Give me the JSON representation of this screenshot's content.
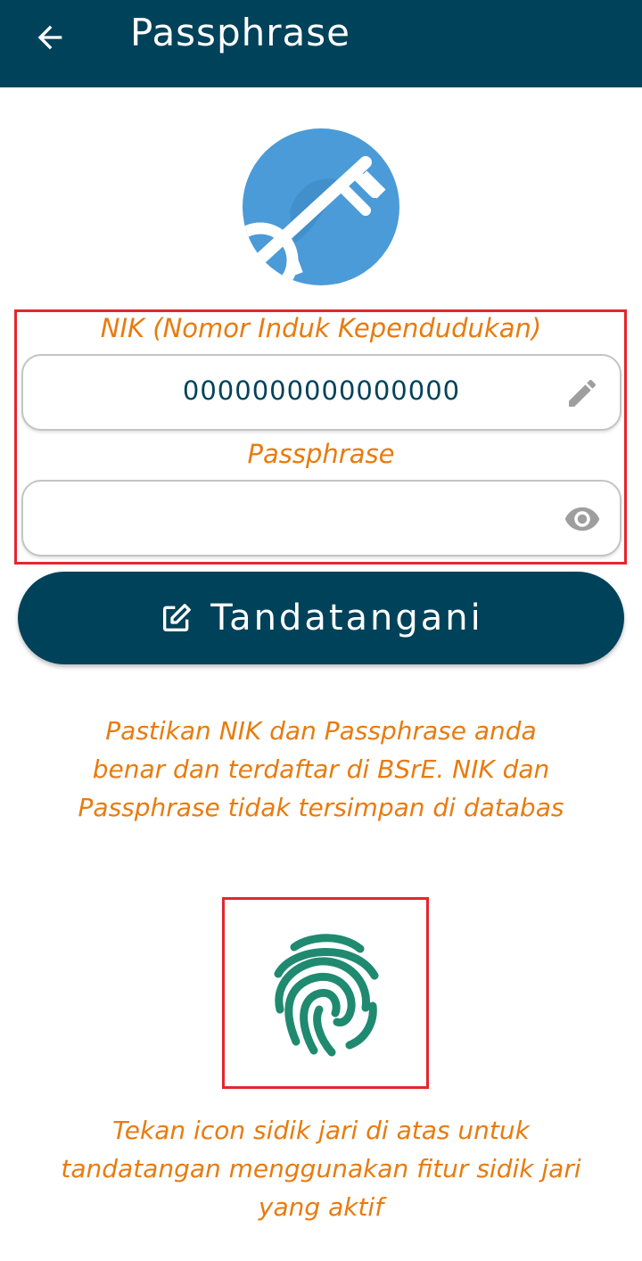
{
  "appbar": {
    "title": "Passphrase",
    "back_icon": "arrow-left-icon"
  },
  "logo": {
    "icon": "key-logo-icon"
  },
  "form": {
    "nik_label": "NIK (Nomor Induk Kependudukan)",
    "nik_value": "0000000000000000",
    "nik_icon": "pencil-edit-icon",
    "passphrase_label": "Passphrase",
    "passphrase_value": "",
    "passphrase_icon": "eye-icon"
  },
  "sign_button": {
    "label": "Tandatangani",
    "icon": "edit-square-icon"
  },
  "info_text": "Pastikan NIK dan Passphrase anda benar dan terdaftar di BSrE. NIK dan Passphrase tidak tersimpan di databas",
  "fingerprint": {
    "icon": "fingerprint-icon",
    "hint": "Tekan icon sidik jari di atas untuk tandatangan menggunakan fitur sidik jari yang aktif"
  },
  "colors": {
    "primary": "#00425a",
    "accent_text": "#e87b0f",
    "highlight_box": "#e3262d",
    "fingerprint": "#1f8a70",
    "logo_blue": "#4a9bd8"
  }
}
